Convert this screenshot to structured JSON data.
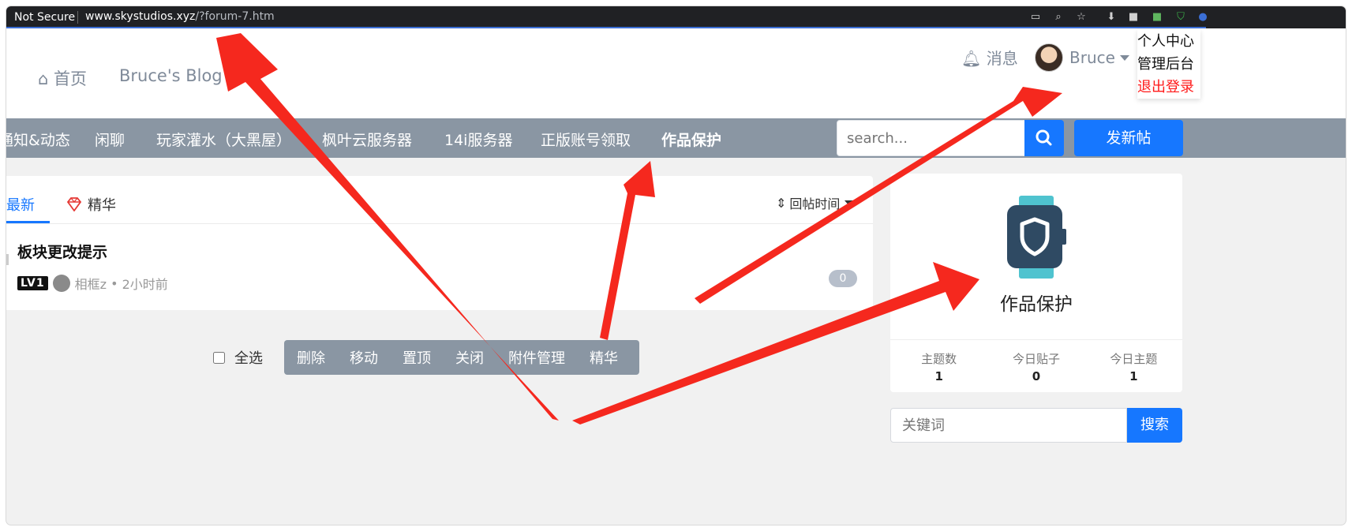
{
  "browser": {
    "security": "Not Secure",
    "url_host": "www.skystudios.xyz",
    "url_path": "/?forum-7.htm"
  },
  "header": {
    "home": "首页",
    "blog": "Bruce's Blog",
    "messages": "消息",
    "username": "Bruce",
    "menu": [
      "个人中心",
      "管理后台",
      "退出登录"
    ]
  },
  "nav": {
    "items": [
      "通知&动态",
      "闲聊",
      "玩家灌水（大黑屋）",
      "枫叶云服务器",
      "14i服务器",
      "正版账号领取",
      "作品保护"
    ],
    "active_index": 6,
    "search_placeholder": "search...",
    "new_post": "发新帖"
  },
  "tabs": {
    "latest": "最新",
    "digest": "精华",
    "sort": "回帖时间"
  },
  "thread": {
    "title": "板块更改提示",
    "level": "LV1",
    "author": "相框z",
    "time": "2小时前",
    "replies": "0"
  },
  "batch": {
    "select_all": "全选",
    "actions": [
      "删除",
      "移动",
      "置顶",
      "关闭",
      "附件管理",
      "精华"
    ]
  },
  "sidebar": {
    "forum_name": "作品保护",
    "stats": [
      {
        "label": "主题数",
        "value": "1"
      },
      {
        "label": "今日贴子",
        "value": "0"
      },
      {
        "label": "今日主题",
        "value": "1"
      }
    ],
    "keyword_placeholder": "关键词",
    "search_btn": "搜索"
  },
  "colors": {
    "accent": "#1677ff",
    "nav_bg": "#8a96a3",
    "logout": "#ff1a1a",
    "arrow": "#f5281e"
  }
}
